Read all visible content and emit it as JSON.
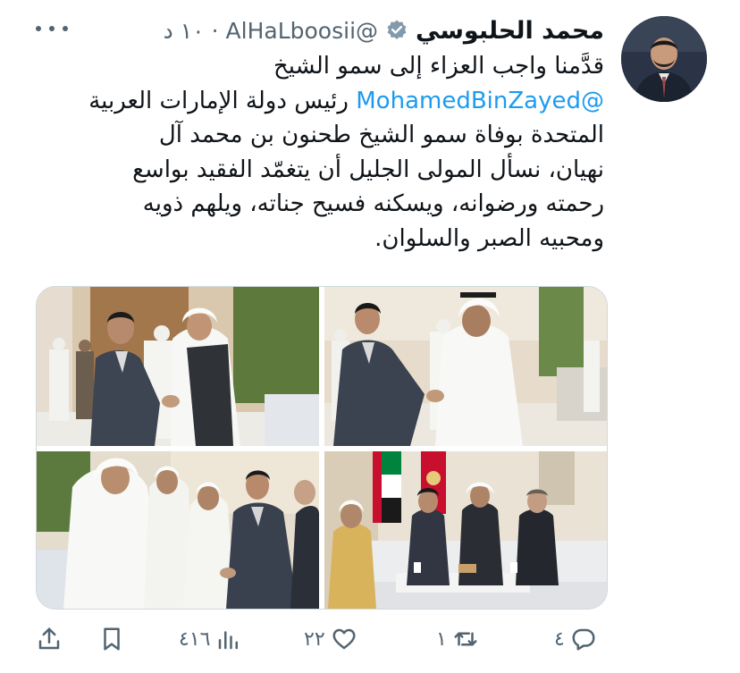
{
  "author": {
    "display_name": "محمد الحلبوسي",
    "handle": "@AlHaLboosii",
    "separator": "·",
    "time": "١٠ د",
    "verified_icon": "verified-badge-icon",
    "verified_color": "#829aab"
  },
  "tweet": {
    "line1": "قدَّمنا واجب العزاء إلى سمو الشيخ",
    "line2_text": "رئيس دولة الإمارات العربية",
    "line2_mention": "@MohamedBinZayed",
    "line3": "المتحدة بوفاة سمو الشيخ طحنون بن محمد آل",
    "line4": "نهيان، نسأل المولى الجليل أن يتغمّد الفقيد بواسع",
    "line5": "رحمته ورضوانه، ويسكنه فسيح جناته، ويلهم ذويه",
    "line6": "ومحبيه الصبر والسلوان.",
    "mention_color": "#1d9bf0"
  },
  "actions": {
    "replies": "٤",
    "retweets": "١",
    "likes": "٢٢",
    "views": "٤١٦",
    "icons": [
      "reply-icon",
      "retweet-icon",
      "like-icon",
      "views-icon",
      "bookmark-icon",
      "share-icon"
    ]
  },
  "colors": {
    "text": "#0f1419",
    "secondary": "#536471",
    "border": "#cfd9de"
  }
}
